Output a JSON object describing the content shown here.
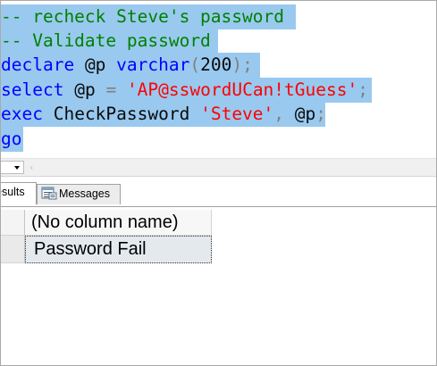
{
  "editor": {
    "lines": [
      {
        "comment": "-- recheck Steve's password"
      },
      {
        "comment": "-- Validate password"
      },
      {
        "keyword": "declare",
        "var": "@p",
        "type": "varchar",
        "lparen": "(",
        "num": "200",
        "rparen": ")",
        "semi": ";"
      },
      {
        "keyword": "select",
        "var": "@p",
        "eq": "=",
        "string": "'AP@sswordUCan!tGuess'",
        "semi": ";"
      },
      {
        "keyword": "exec",
        "func": "CheckPassword",
        "string": "'Steve'",
        "comma": ",",
        "var": "@p",
        "semi": ";"
      },
      {
        "keyword": "go"
      }
    ]
  },
  "results": {
    "tabs": [
      {
        "label": "esults",
        "selected": true
      },
      {
        "label": "Messages",
        "selected": false
      }
    ],
    "grid": {
      "column_header": "(No column name)",
      "rows": [
        "Password Fail"
      ]
    }
  },
  "colors": {
    "selection": "#99c9ef",
    "comment": "#008000",
    "keyword": "#0000ff",
    "string": "#ff0000",
    "operator": "#808080"
  },
  "icons": {
    "messages_tab": "messages-icon",
    "zoom_dropdown": "chevron-down-icon",
    "scroll_left": "scroll-left-icon"
  }
}
